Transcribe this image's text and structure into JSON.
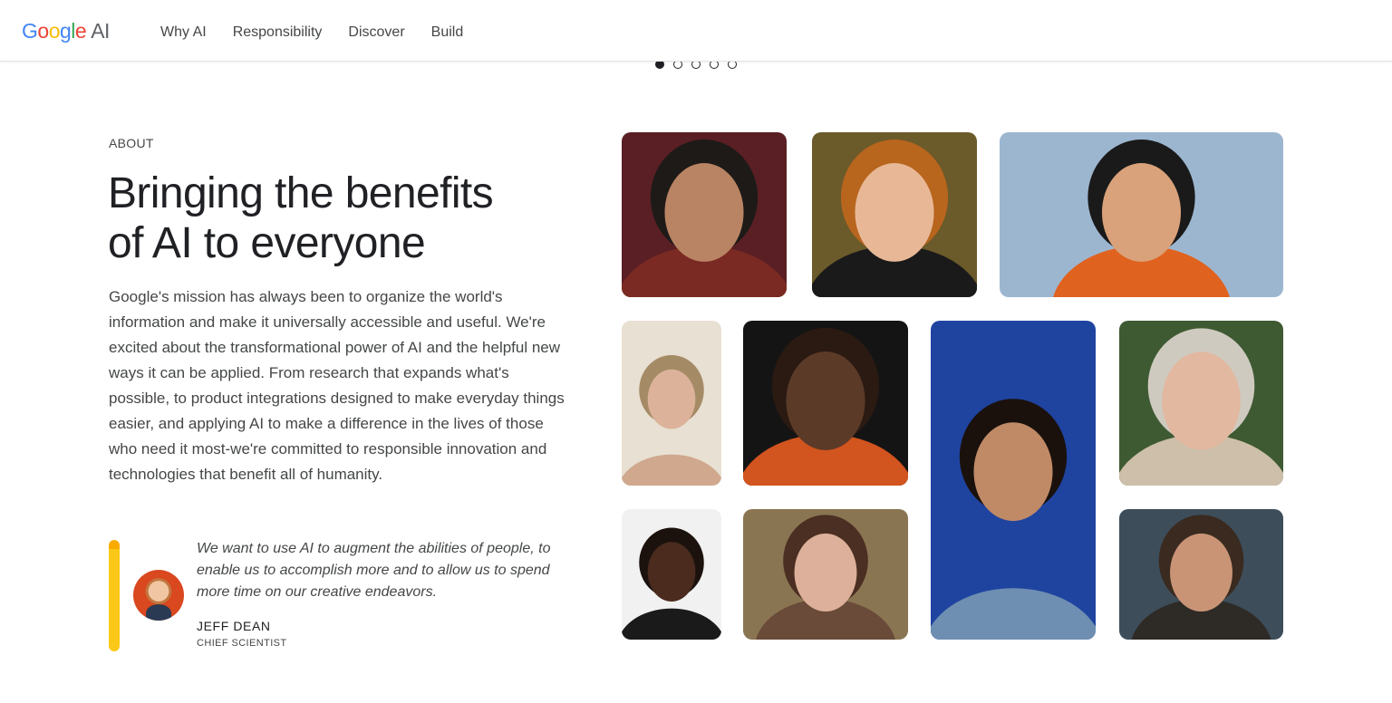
{
  "header": {
    "logo_google": [
      "G",
      "o",
      "o",
      "g",
      "l",
      "e"
    ],
    "logo_ai": "AI",
    "nav": [
      "Why AI",
      "Responsibility",
      "Discover",
      "Build"
    ]
  },
  "carousel": {
    "total": 5,
    "active": 1
  },
  "about": {
    "eyebrow": "ABOUT",
    "headline_line1": "Bringing the benefits",
    "headline_line2": "of AI to everyone",
    "body": "Google's mission has always been to organize the world's information and make it universally accessible and useful. We're excited about the transformational power of AI and the helpful new ways it can be applied. From research that expands what's possible, to product integrations designed to make everyday things easier, and applying AI to make a difference in the lives of those who need it most-we're committed to responsible innovation and technologies that benefit all of humanity."
  },
  "quote": {
    "text": "We want to use AI to augment the abilities of people, to enable us to accomplish more and to allow us to spend more time on our creative endeavors.",
    "name": "JEFF DEAN",
    "role": "CHIEF SCIENTIST"
  },
  "colors": {
    "google_blue": "#4285F4",
    "google_red": "#EA4335",
    "google_yellow": "#FBBC05",
    "google_green": "#34A853",
    "quote_bar": "#FBC817"
  },
  "photos": [
    {
      "name": "photo-elderly-man",
      "bg": "#5a1f24",
      "skin": "#b98463",
      "hair": "#1e1a18",
      "shirt": "#7a2a22"
    },
    {
      "name": "photo-redhead-person",
      "bg": "#6b5a2a",
      "skin": "#e8b896",
      "hair": "#b8651e",
      "shirt": "#1a1a1a"
    },
    {
      "name": "photo-woman-orange-hood",
      "bg": "#9db6d0",
      "skin": "#d9a27a",
      "hair": "#1a1a1a",
      "shirt": "#e0621f"
    },
    {
      "name": "photo-woman-glasses",
      "bg": "#e8e0d2",
      "skin": "#dcb39a",
      "hair": "#a58a66",
      "shirt": "#cfa88e"
    },
    {
      "name": "photo-bald-man",
      "bg": "#141414",
      "skin": "#5b3a28",
      "hair": "#2b1a12",
      "shirt": "#d2541e"
    },
    {
      "name": "photo-smiling-woman-blue",
      "bg": "#1f44a0",
      "skin": "#c08a67",
      "hair": "#1a110d",
      "shirt": "#6f8fb2"
    },
    {
      "name": "photo-gray-haired-woman",
      "bg": "#3e5a32",
      "skin": "#e2b8a0",
      "hair": "#cfcac0",
      "shirt": "#cdbfa9"
    },
    {
      "name": "photo-young-woman-dark",
      "bg": "#f1f1f1",
      "skin": "#4a2b1e",
      "hair": "#1c120d",
      "shirt": "#1a1a1a"
    },
    {
      "name": "photo-woman-brown-hair",
      "bg": "#8a7552",
      "skin": "#dcb09a",
      "hair": "#4a2f22",
      "shirt": "#6a4a38"
    },
    {
      "name": "photo-woman-slate",
      "bg": "#3d4d5a",
      "skin": "#c99476",
      "hair": "#3a2a1f",
      "shirt": "#2e2a26"
    }
  ]
}
